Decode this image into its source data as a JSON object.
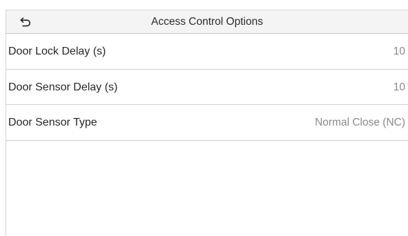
{
  "header": {
    "title": "Access Control Options",
    "back_icon": "back-arrow-icon"
  },
  "settings": [
    {
      "label": "Door Lock Delay (s)",
      "value": "10"
    },
    {
      "label": "Door Sensor Delay (s)",
      "value": "10"
    },
    {
      "label": "Door Sensor Type",
      "value": "Normal Close (NC)"
    }
  ],
  "colors": {
    "header_bg": "#f4f4f4",
    "divider": "#cfcfcf",
    "label_text": "#262626",
    "value_text": "#8a8a8a"
  }
}
